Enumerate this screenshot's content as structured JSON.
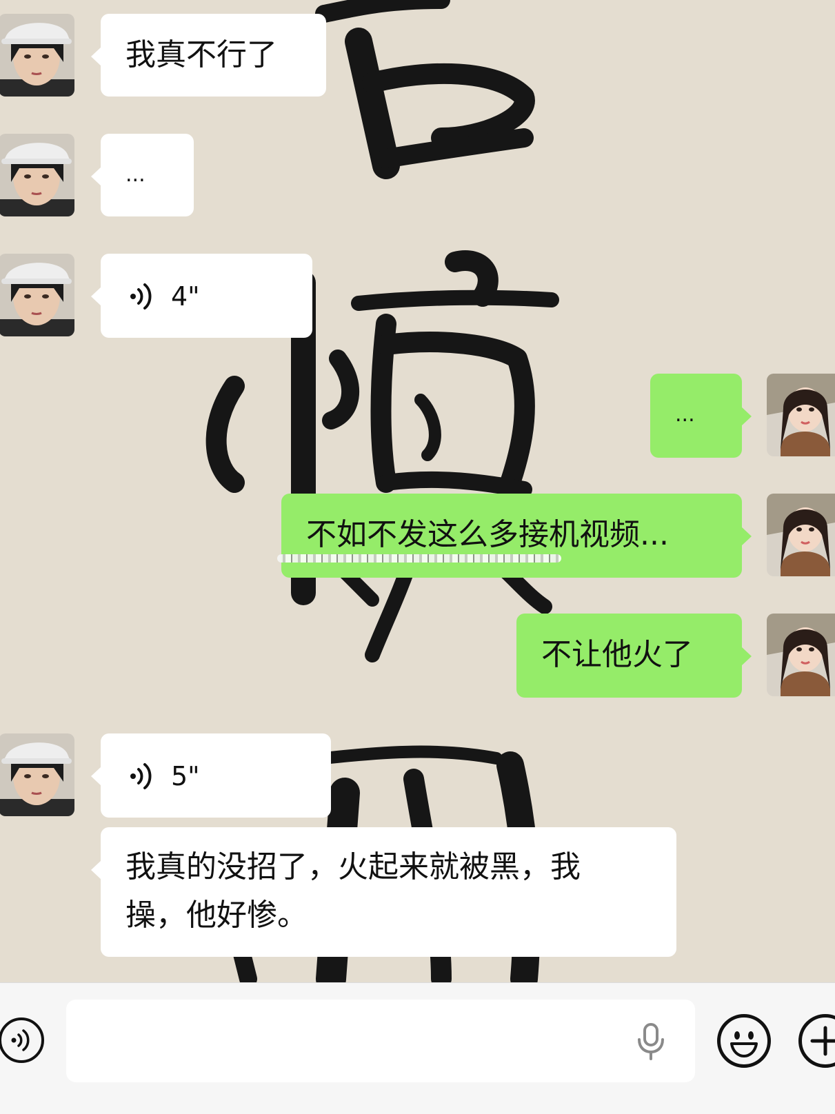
{
  "messages": [
    {
      "side": "in",
      "type": "text",
      "text": "我真不行了"
    },
    {
      "side": "in",
      "type": "text",
      "text": "..."
    },
    {
      "side": "in",
      "type": "voice",
      "duration": "4\""
    },
    {
      "side": "out",
      "type": "text",
      "text": "..."
    },
    {
      "side": "out",
      "type": "text",
      "text": "不如不发这么多接机视频..."
    },
    {
      "side": "out",
      "type": "text",
      "text": "不让他火了"
    },
    {
      "side": "in",
      "type": "voice",
      "duration": "5\""
    },
    {
      "side": "in",
      "type": "text",
      "text_line1": "我真的没招了，火起来就被黑，我",
      "text_line2": "操，他好惨。"
    }
  ],
  "input_bar": {
    "left_icon": "voice-mode-icon",
    "mic_icon": "microphone-icon",
    "emoji_icon": "emoji-icon",
    "more_icon": "plus-icon"
  },
  "colors": {
    "incoming_bubble": "#ffffff",
    "outgoing_bubble": "#95ec69",
    "background": "#e4ddd0"
  }
}
